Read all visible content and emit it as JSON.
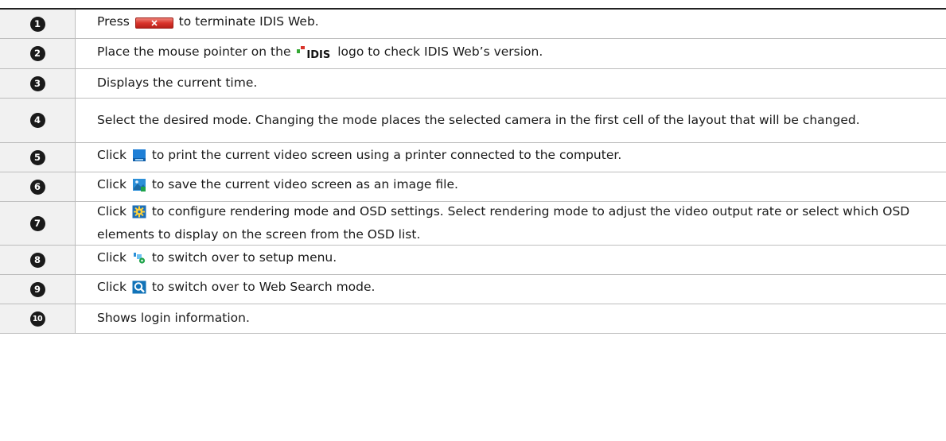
{
  "rows": [
    {
      "num": "1",
      "pre": "Press",
      "icon": "close-button-icon",
      "post": "to terminate IDIS Web."
    },
    {
      "num": "2",
      "pre": "Place the mouse pointer on the",
      "icon": "idis-logo",
      "logo_text": "IDIS",
      "post": "logo to check IDIS Web’s version."
    },
    {
      "num": "3",
      "text": "Displays the current time."
    },
    {
      "num": "4",
      "text": "Select the desired mode. Changing the mode places the selected camera in the first cell of the layout that will be changed."
    },
    {
      "num": "5",
      "pre": "Click",
      "icon": "print-icon",
      "post": "to print the current video screen using a printer connected to the computer."
    },
    {
      "num": "6",
      "pre": "Click",
      "icon": "save-image-icon",
      "post": "to save the current video screen as an image file."
    },
    {
      "num": "7",
      "pre": "Click",
      "icon": "settings-gear-icon",
      "post": "to configure rendering mode and OSD settings. Select rendering mode to adjust the video output rate or select which OSD elements to display on the screen from the OSD list."
    },
    {
      "num": "8",
      "pre": "Click",
      "icon": "setup-menu-icon",
      "post": "to switch over to setup menu."
    },
    {
      "num": "9",
      "pre": "Click",
      "icon": "search-icon",
      "post": "to switch over to Web Search mode."
    },
    {
      "num": "10",
      "text": "Shows login information."
    }
  ],
  "colors": {
    "close_button": "#d9342b",
    "print_icon": "#1e7fd6",
    "settings_icon": "#2a9bd6",
    "search_icon": "#1173b8"
  }
}
